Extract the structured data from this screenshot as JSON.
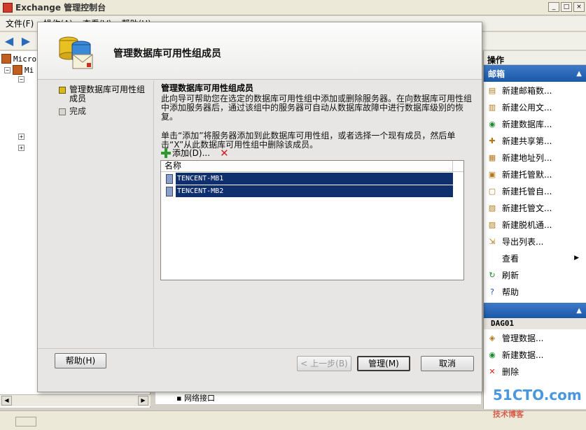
{
  "app": {
    "title": "Exchange 管理控制台",
    "menu": [
      "文件(F)",
      "操作(A)",
      "查看(V)",
      "帮助(H)"
    ]
  },
  "tree": {
    "items": [
      "Micro",
      "Mi"
    ]
  },
  "actions": {
    "title": "操作",
    "mailbox_header": "邮箱",
    "items": [
      {
        "label": "新建邮箱数...",
        "icon": "mailbox-db-icon"
      },
      {
        "label": "新建公用文...",
        "icon": "public-folder-icon"
      },
      {
        "label": "新建数据库...",
        "icon": "database-icon"
      },
      {
        "label": "新建共享第...",
        "icon": "share-icon"
      },
      {
        "label": "新建地址列...",
        "icon": "address-list-icon"
      },
      {
        "label": "新建托管默...",
        "icon": "managed-default-icon"
      },
      {
        "label": "新建托管自...",
        "icon": "managed-custom-icon"
      },
      {
        "label": "新建托管文...",
        "icon": "managed-folder-icon"
      },
      {
        "label": "新建脱机通...",
        "icon": "offline-address-icon"
      },
      {
        "label": "导出列表...",
        "icon": "export-icon"
      },
      {
        "label": "查看",
        "icon": "view-icon"
      },
      {
        "label": "刷新",
        "icon": "refresh-icon"
      },
      {
        "label": "帮助",
        "icon": "help-icon"
      }
    ],
    "dag_label": "DAG01",
    "dag_items": [
      {
        "label": "管理数据...",
        "icon": "manage-db-icon"
      },
      {
        "label": "新建数据...",
        "icon": "new-db-icon"
      },
      {
        "label": "删除",
        "icon": "delete-icon"
      }
    ]
  },
  "behind": {
    "network_label": "网络接口"
  },
  "dialog": {
    "title": "管理数据库可用性组成员",
    "steps": [
      {
        "label": "管理数据库可用性组成员",
        "state": "current"
      },
      {
        "label": "完成",
        "state": "pending"
      }
    ],
    "content_title": "管理数据库可用性组成员",
    "desc1": "此向导可帮助您在选定的数据库可用性组中添加或删除服务器。在向数据库可用性组中添加服务器后，通过该组中的服务器可自动从数据库故障中进行数据库级别的恢复。",
    "desc2": "单击“添加”将服务器添加到此数据库可用性组，或者选择一个现有成员，然后单击“X”从此数据库可用性组中删除该成员。",
    "add_label": "添加(D)...",
    "list_header": "名称",
    "members": [
      "TENCENT-MB1",
      "TENCENT-MB2"
    ],
    "buttons": {
      "help": "帮助(H)",
      "back": "< 上一步(B)",
      "manage": "管理(M)",
      "cancel": "取消"
    }
  },
  "watermark": {
    "text": "51CTO.com",
    "sub": "技术博客"
  }
}
